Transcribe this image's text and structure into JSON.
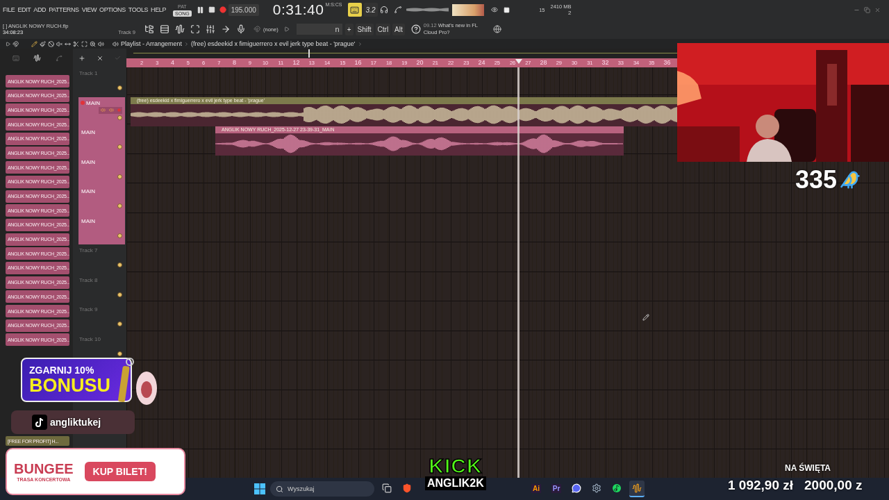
{
  "menu": [
    "FILE",
    "EDIT",
    "ADD",
    "PATTERNS",
    "VIEW",
    "OPTIONS",
    "TOOLS",
    "HELP"
  ],
  "mode_toggle": [
    {
      "label": "PAT",
      "selected": false
    },
    {
      "label": "SONG",
      "selected": true
    }
  ],
  "transport": {
    "tempo": "195.000",
    "time": "0:31:40",
    "time_unit": "M:S:CS",
    "typing_keyboard": true,
    "countdown": "3.2"
  },
  "monitor": {
    "cpu": "15",
    "memory": "2410 MB",
    "voices": "2"
  },
  "project": {
    "file": "[ ] ANGLIK NOWY RUCH.flp",
    "time": "34:08:23",
    "hint": "Track 9"
  },
  "pattern": "(none)",
  "snap_field": "n",
  "keys": [
    "+",
    "Shift",
    "Ctrl",
    "Alt"
  ],
  "news": {
    "date": "09.12",
    "text": "What's new in FL Cloud Pro?"
  },
  "playlist": {
    "title": "Playlist - Arrangement",
    "current": "(free) esdeekid x fimiguerrero x evil jerk type beat - 'prague'",
    "ruler": [
      "2",
      "3",
      "4",
      "5",
      "6",
      "7",
      "8",
      "9",
      "10",
      "11",
      "12",
      "13",
      "14",
      "15",
      "16",
      "17",
      "18",
      "19",
      "20",
      "21",
      "22",
      "23",
      "24",
      "25",
      "26",
      "27",
      "28",
      "29",
      "30",
      "31",
      "32",
      "33",
      "34",
      "35",
      "36"
    ],
    "tracks": [
      {
        "name": "Track 1",
        "kind": "empty",
        "armed": false
      },
      {
        "name": "MAIN",
        "kind": "audio",
        "armed": true
      },
      {
        "name": "MAIN",
        "kind": "audio",
        "armed": false
      },
      {
        "name": "MAIN",
        "kind": "audio",
        "armed": false
      },
      {
        "name": "MAIN",
        "kind": "audio",
        "armed": false
      },
      {
        "name": "MAIN",
        "kind": "audio",
        "armed": false
      },
      {
        "name": "Track 7",
        "kind": "empty",
        "armed": false
      },
      {
        "name": "Track 8",
        "kind": "empty",
        "armed": false
      },
      {
        "name": "Track 9",
        "kind": "empty",
        "armed": false
      },
      {
        "name": "Track 10",
        "kind": "empty",
        "armed": false
      }
    ],
    "clips": [
      {
        "title": "(free) esdeekid x fimiguerrero x evil jerk type beat - 'prague'",
        "kind": "beat"
      },
      {
        "title": "ANGLIK NOWY RUCH_2025-12-27 23-39-31_MAIN",
        "kind": "vocal"
      }
    ]
  },
  "browser": {
    "items": [
      "ANGLIK NOWY RUCH_2025...",
      "ANGLIK NOWY RUCH_2025...",
      "ANGLIK NOWY RUCH_2025...",
      "ANGLIK NOWY RUCH_2025...",
      "ANGLIK NOWY RUCH_2025...",
      "ANGLIK NOWY RUCH_2025...",
      "ANGLIK NOWY RUCH_2025...",
      "ANGLIK NOWY RUCH_2025...",
      "ANGLIK NOWY RUCH_2025...",
      "ANGLIK NOWY RUCH_2025...",
      "ANGLIK NOWY RUCH_2025...",
      "ANGLIK NOWY RUCH_2025...",
      "ANGLIK NOWY RUCH_2025...",
      "ANGLIK NOWY RUCH_2025...",
      "ANGLIK NOWY RUCH_2025...",
      "ANGLIK NOWY RUCH_2025...",
      "ANGLIK NOWY RUCH_2025...",
      "ANGLIK NOWY RUCH_2025...",
      "ANGLIK NOWY RUCH_2025..."
    ],
    "lower_items": [
      "[FREE FOR PROFIT] H..."
    ]
  },
  "overlays": {
    "counter": "335",
    "promo": {
      "line1": "ZGARNIJ 10%",
      "line2": "BONUSU"
    },
    "tiktok": "angliktukej",
    "bungee": {
      "brand": "BUNGEE",
      "subtitle": "TRASA KONCERTOWA",
      "button": "KUP BILET!"
    },
    "kick": {
      "brand": "KICK",
      "channel": "ANGLIK2K"
    },
    "goal": {
      "title": "NA ŚWIĘTA",
      "current": "1 092,90 zł",
      "target": "2000,00 z"
    }
  },
  "taskbar": {
    "search_placeholder": "Wyszukaj",
    "apps": [
      {
        "kind": "task-view",
        "selected": false
      },
      {
        "kind": "browser",
        "selected": false
      },
      {
        "kind": "text",
        "label": "Ai",
        "selected": false
      },
      {
        "kind": "text",
        "label": "Pr",
        "selected": false
      },
      {
        "kind": "chat",
        "selected": false
      },
      {
        "kind": "settings",
        "selected": false
      },
      {
        "kind": "music",
        "selected": false
      },
      {
        "kind": "daw",
        "selected": true
      }
    ]
  }
}
